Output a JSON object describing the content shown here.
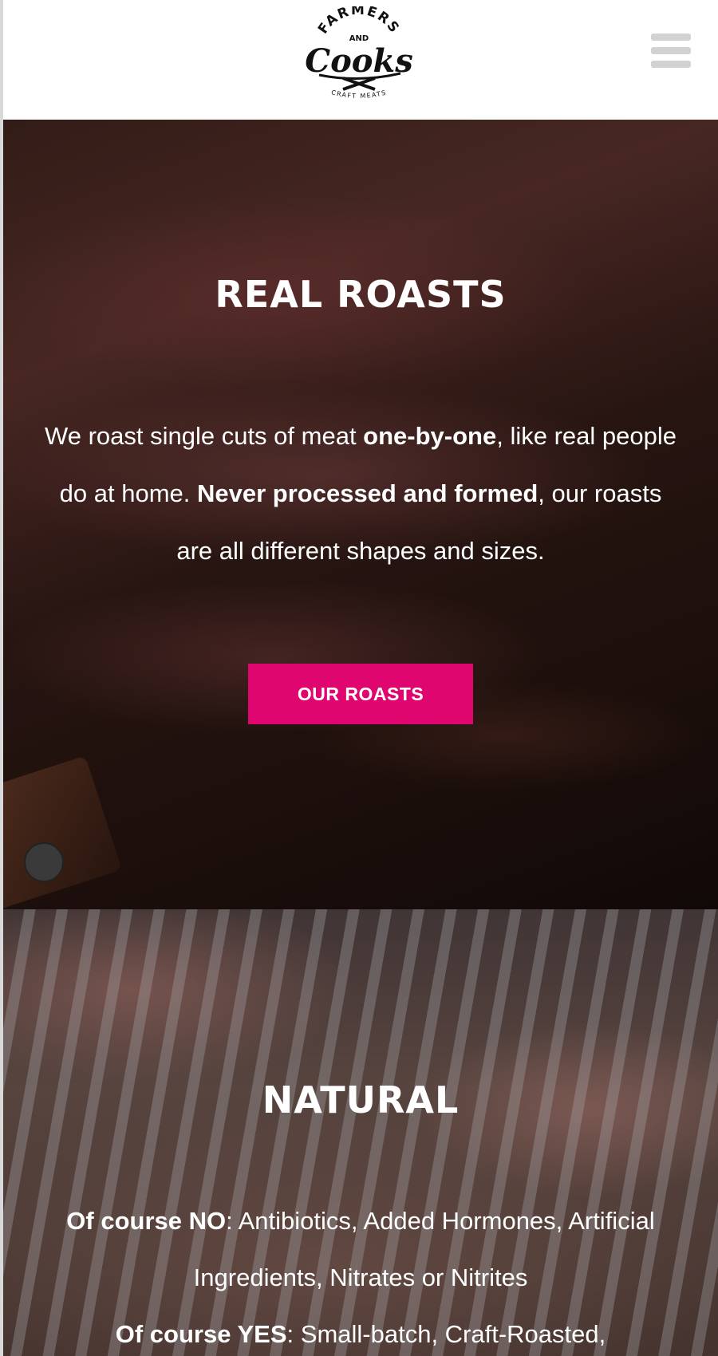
{
  "header": {
    "logo": {
      "top_text": "FARMERS",
      "middle_text": "AND",
      "main_text": "Cooks",
      "bottom_text": "CRAFT MEATS"
    },
    "menu_icon": "hamburger-menu-icon"
  },
  "roasts": {
    "title": "REAL ROASTS",
    "body": {
      "p1": "We roast single cuts of meat ",
      "b1": "one-by-one",
      "p2": ", like real people do at home.  ",
      "b2": "Never processed and formed",
      "p3": ", our roasts are all different shapes and sizes."
    },
    "button_label": "OUR ROASTS"
  },
  "natural": {
    "title": "NATURAL",
    "no_label": "Of course NO",
    "no_text": ": Antibiotics, Added Hormones, Artificial Ingredients, Nitrates or Nitrites",
    "yes_label": "Of course YES",
    "yes_text": ":  Small-batch, Craft-Roasted,"
  },
  "colors": {
    "accent": "#e0066f",
    "header_bg": "#ffffff",
    "menu_icon": "#d2d2d2"
  }
}
